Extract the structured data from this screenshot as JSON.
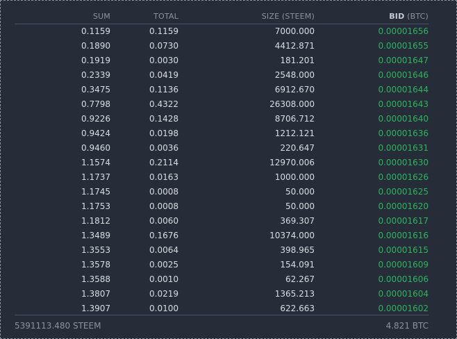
{
  "headers": {
    "sum": "SUM",
    "total": "TOTAL",
    "size": "SIZE (STEEM)",
    "bid_strong": "BID",
    "bid_unit": " (BTC)"
  },
  "rows": [
    {
      "sum": "0.1159",
      "total": "0.1159",
      "size": "7000.000",
      "bid": "0.00001656"
    },
    {
      "sum": "0.1890",
      "total": "0.0730",
      "size": "4412.871",
      "bid": "0.00001655"
    },
    {
      "sum": "0.1919",
      "total": "0.0030",
      "size": "181.201",
      "bid": "0.00001647"
    },
    {
      "sum": "0.2339",
      "total": "0.0419",
      "size": "2548.000",
      "bid": "0.00001646"
    },
    {
      "sum": "0.3475",
      "total": "0.1136",
      "size": "6912.670",
      "bid": "0.00001644"
    },
    {
      "sum": "0.7798",
      "total": "0.4322",
      "size": "26308.000",
      "bid": "0.00001643"
    },
    {
      "sum": "0.9226",
      "total": "0.1428",
      "size": "8706.712",
      "bid": "0.00001640"
    },
    {
      "sum": "0.9424",
      "total": "0.0198",
      "size": "1212.121",
      "bid": "0.00001636"
    },
    {
      "sum": "0.9460",
      "total": "0.0036",
      "size": "220.647",
      "bid": "0.00001631"
    },
    {
      "sum": "1.1574",
      "total": "0.2114",
      "size": "12970.006",
      "bid": "0.00001630"
    },
    {
      "sum": "1.1737",
      "total": "0.0163",
      "size": "1000.000",
      "bid": "0.00001626"
    },
    {
      "sum": "1.1745",
      "total": "0.0008",
      "size": "50.000",
      "bid": "0.00001625"
    },
    {
      "sum": "1.1753",
      "total": "0.0008",
      "size": "50.000",
      "bid": "0.00001620"
    },
    {
      "sum": "1.1812",
      "total": "0.0060",
      "size": "369.307",
      "bid": "0.00001617"
    },
    {
      "sum": "1.3489",
      "total": "0.1676",
      "size": "10374.000",
      "bid": "0.00001616"
    },
    {
      "sum": "1.3553",
      "total": "0.0064",
      "size": "398.965",
      "bid": "0.00001615"
    },
    {
      "sum": "1.3578",
      "total": "0.0025",
      "size": "154.091",
      "bid": "0.00001609"
    },
    {
      "sum": "1.3588",
      "total": "0.0010",
      "size": "62.267",
      "bid": "0.00001606"
    },
    {
      "sum": "1.3807",
      "total": "0.0219",
      "size": "1365.213",
      "bid": "0.00001604"
    },
    {
      "sum": "1.3907",
      "total": "0.0100",
      "size": "622.663",
      "bid": "0.00001602"
    }
  ],
  "footer": {
    "total_steem": "5391113.480 STEEM",
    "total_btc": "4.821 BTC"
  },
  "colors": {
    "background": "#272d38",
    "bid_green": "#2eb35e",
    "text": "#d9dde3",
    "muted": "#8b939e"
  }
}
